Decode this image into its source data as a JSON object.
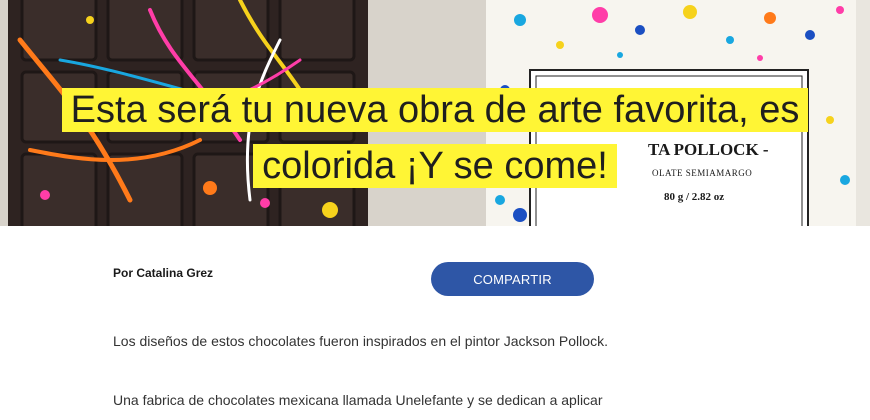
{
  "article": {
    "headline_line1": "Esta será tu nueva obra de arte favorita, es",
    "headline_line2": "colorida ¡Y se come!",
    "author": "Por Catalina Grez",
    "share_label": "COMPARTIR",
    "paragraphs": [
      "Los diseños de estos chocolates fueron inspirados en el pintor Jackson Pollock.",
      "Una fabrica de chocolates mexicana llamada Unelefante y se dedican a aplicar"
    ]
  },
  "hero_image": {
    "label_line1": "TA POLLOCK -",
    "label_line2": "OLATE SEMIAMARGO",
    "label_weight": "80 g / 2.82 oz"
  },
  "colors": {
    "highlight": "#fff535",
    "button": "#2e56a6",
    "chocolate": "#2e2321"
  }
}
